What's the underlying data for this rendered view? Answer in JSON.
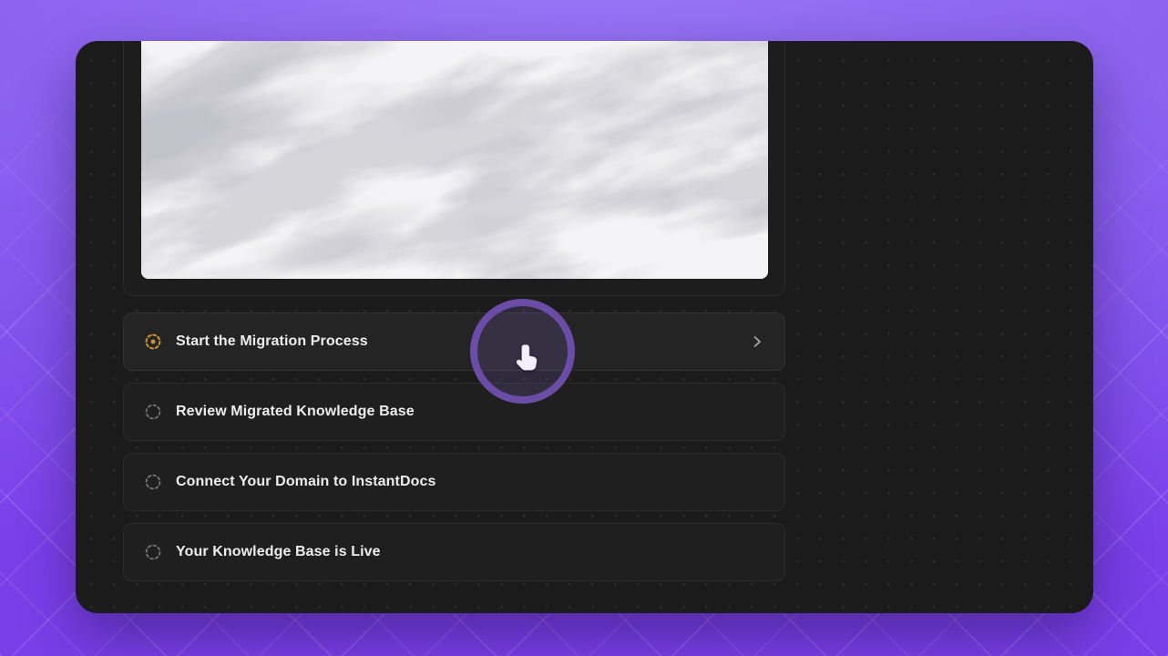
{
  "page": {
    "name": "onboarding-checklist"
  },
  "cover": {
    "image_name": "marble-texture-preview"
  },
  "checklist": {
    "items": [
      {
        "id": "start-migration-process",
        "label": "Start the Migration Process",
        "status": "in_progress",
        "icon": "in-progress-dashed-circle-icon",
        "chevron": true
      },
      {
        "id": "review-migrated-knowledge-base",
        "label": "Review Migrated Knowledge Base",
        "status": "pending",
        "icon": "pending-dashed-circle-icon",
        "chevron": false
      },
      {
        "id": "connect-your-domain-to-instantdocs",
        "label": "Connect Your Domain to InstantDocs",
        "status": "pending",
        "icon": "pending-dashed-circle-icon",
        "chevron": false
      },
      {
        "id": "your-knowledge-base-is-live",
        "label": "Your Knowledge Base is Live",
        "status": "pending",
        "icon": "pending-dashed-circle-icon",
        "chevron": false
      }
    ]
  },
  "cursor": {
    "type": "hand-pointer",
    "highlight_ring": true
  },
  "colors": {
    "background_top": "#9876f5",
    "background_bottom": "#7a3fe9",
    "card_bg": "#1b1b1b",
    "row_bg": "#1f1f1f",
    "row_border": "#2c2c2c",
    "in_progress_accent": "#c9922f",
    "pending_icon": "#777777",
    "text_primary": "#ededed",
    "chevron": "#a8a8a8",
    "spotlight_ring": "#6b4da8"
  }
}
